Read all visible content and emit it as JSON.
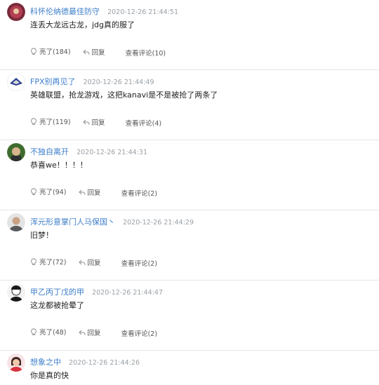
{
  "comments": [
    {
      "name": "科怀伦纳德最佳防守",
      "time": "2020-12-26 21:44:51",
      "text": "连丢大龙远古龙，jdg真的服了",
      "like": "亮了(184)",
      "reply": "回复",
      "view": "查看评论(10)"
    },
    {
      "name": "FPX别再见了",
      "time": "2020-12-26 21:44:49",
      "text": "英雄联盟，抢龙游戏，这把kanavi是不是被抢了两条了",
      "like": "亮了(119)",
      "reply": "回复",
      "view": "查看评论(4)"
    },
    {
      "name": "不独自离开",
      "time": "2020-12-26 21:44:31",
      "text": "恭喜we！！！！",
      "like": "亮了(94)",
      "reply": "回复",
      "view": "查看评论(2)"
    },
    {
      "name": "浑元形意掌门人马保国丶",
      "time": "2020-12-26 21:44:29",
      "text": "旧梦！",
      "like": "亮了(72)",
      "reply": "回复",
      "view": "查看评论(2)"
    },
    {
      "name": "甲乙丙丁戊的甲",
      "time": "2020-12-26 21:44:47",
      "text": "这龙都被抢晕了",
      "like": "亮了(48)",
      "reply": "回复",
      "view": "查看评论(2)"
    },
    {
      "name": "想象之中",
      "time": "2020-12-26 21:44:26",
      "text": "你是真的快",
      "like": "",
      "reply": "",
      "view": ""
    }
  ],
  "icons": {
    "like": "lightbulb-icon",
    "reply": "reply-arrow-icon"
  },
  "colors": {
    "username": "#3d7ec9",
    "timestamp": "#9aa0a6",
    "divider": "#e6e6e6"
  }
}
